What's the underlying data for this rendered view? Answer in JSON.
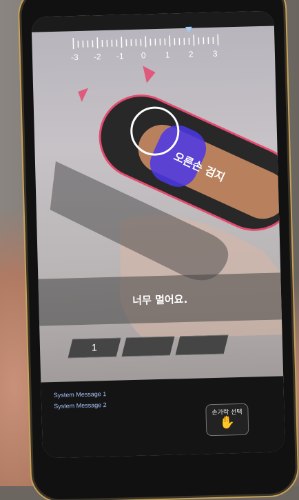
{
  "header": {
    "title": ""
  },
  "ruler": {
    "labels": [
      "-3",
      "-2",
      "-1",
      "0",
      "1",
      "2",
      "3"
    ],
    "indicator_value": 1.5,
    "indicator_color": "#9fd0ff"
  },
  "finger_target": {
    "label": "오른손 검지",
    "outline_color": "#e8416a",
    "highlight_color": "#4a37e6",
    "marker_color": "#e8416a"
  },
  "message": {
    "text": "너무 멀어요."
  },
  "progress": {
    "segments": [
      "1",
      "",
      ""
    ],
    "current_step": 1
  },
  "system": {
    "message_1": "System Message 1",
    "message_2": "System Message 2"
  },
  "finger_select": {
    "label": "손가락 선택",
    "icon": "hand-icon"
  }
}
